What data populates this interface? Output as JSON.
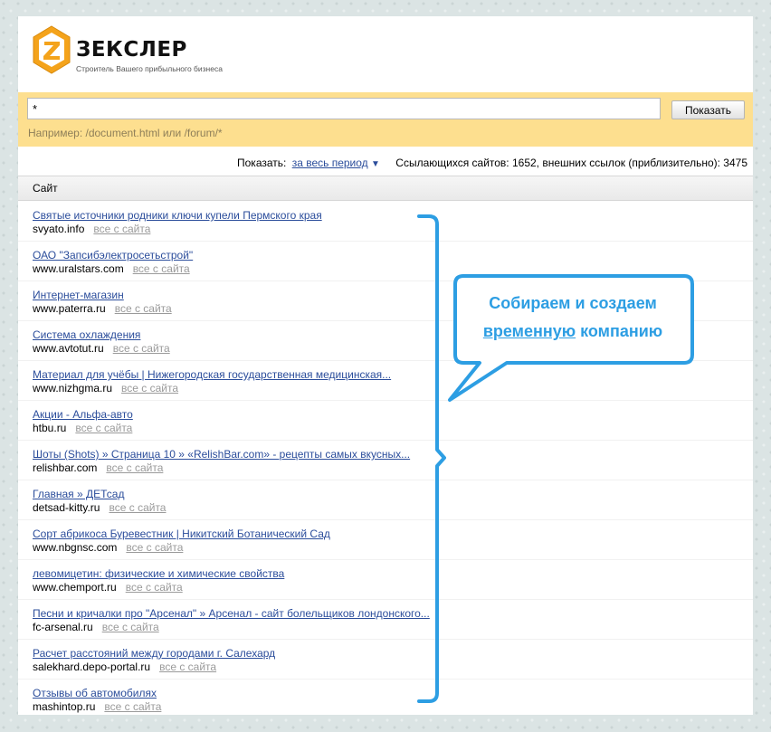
{
  "brand": {
    "logo_letter": "Z",
    "name": "ЗЕКСЛЕР",
    "tagline": "Строитель Вашего прибыльного бизнеса"
  },
  "search": {
    "value": "*",
    "button_label": "Показать",
    "hint": "Например: /document.html или /forum/*"
  },
  "filter": {
    "show_label": "Показать:",
    "period_link": "за весь период",
    "period_arrow": "▼",
    "summary": "Ссылающихся сайтов: 1652, внешних ссылок (приблизительно): 3475"
  },
  "table": {
    "column_header": "Сайт",
    "all_label": "все с сайта",
    "rows": [
      {
        "title": "Святые источники родники ключи купели Пермского края",
        "domain": "svyato.info"
      },
      {
        "title": "ОАО \"Зап­сибэлектросетьстрой\"",
        "domain": "www.uralstars.com"
      },
      {
        "title": "Интернет-магазин",
        "domain": "www.paterra.ru"
      },
      {
        "title": "Система охлаждения",
        "domain": "www.avtotut.ru"
      },
      {
        "title": "Материал для учёбы | Нижегородская государственная медицинская...",
        "domain": "www.nizhgma.ru"
      },
      {
        "title": "Акции - Альфа-авто",
        "domain": "htbu.ru"
      },
      {
        "title": "Шоты (Shots) » Страница 10 » «RelishBar.com» - рецепты самых вкусных...",
        "domain": "relishbar.com"
      },
      {
        "title": "Главная » ДЕТсад",
        "domain": "detsad-kitty.ru"
      },
      {
        "title": "Сорт абрикоса Буревестник | Никитский Ботанический Сад",
        "domain": "www.nbgnsc.com"
      },
      {
        "title": "левомицетин: физические и химические свойства",
        "domain": "www.chemport.ru"
      },
      {
        "title": "Песни и кричалки про \"Арсенал\" » Арсенал - сайт болельщиков лондонского...",
        "domain": "fc-arsenal.ru"
      },
      {
        "title": "Расчет расстояний между городами г. Салехард",
        "domain": "salekhard.depo-portal.ru"
      },
      {
        "title": "Отзывы об автомобилях",
        "domain": "mashintop.ru"
      }
    ]
  },
  "annotation": {
    "line1": "Собираем и создаем",
    "line2_underlined": "временную",
    "line2_rest": " компанию"
  },
  "colors": {
    "accent_orange": "#f4a31b",
    "panel_yellow": "#fddf8f",
    "link_blue": "#2b4d9b",
    "annotation_blue": "#2d9ee3"
  }
}
